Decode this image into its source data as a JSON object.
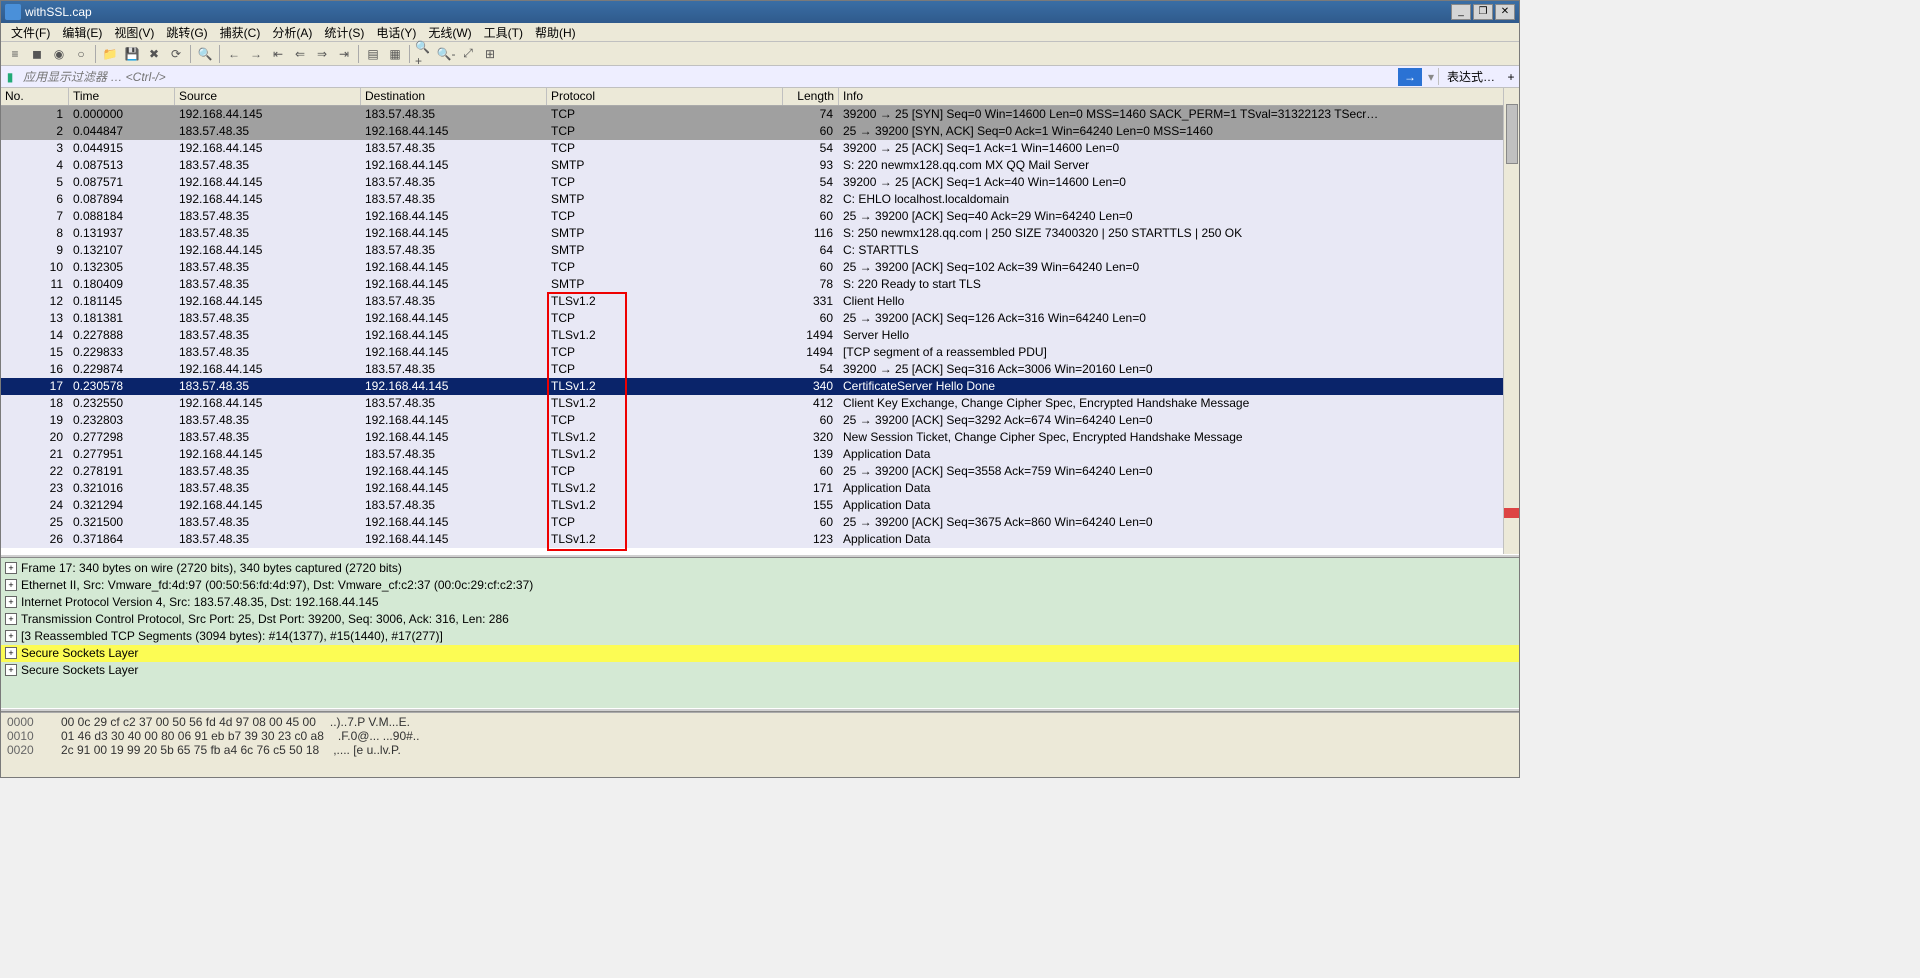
{
  "title": "withSSL.cap",
  "menu": [
    "文件(F)",
    "编辑(E)",
    "视图(V)",
    "跳转(G)",
    "捕获(C)",
    "分析(A)",
    "统计(S)",
    "电话(Y)",
    "无线(W)",
    "工具(T)",
    "帮助(H)"
  ],
  "filter_placeholder": "应用显示过滤器 … <Ctrl-/>",
  "expr_label": "表达式…",
  "columns": {
    "no": "No.",
    "time": "Time",
    "src": "Source",
    "dst": "Destination",
    "proto": "Protocol",
    "len": "Length",
    "info": "Info"
  },
  "packets": [
    {
      "no": 1,
      "time": "0.000000",
      "src": "192.168.44.145",
      "dst": "183.57.48.35",
      "proto": "TCP",
      "len": 74,
      "info": "39200 → 25 [SYN] Seq=0 Win=14600 Len=0 MSS=1460 SACK_PERM=1 TSval=31322123 TSecr…",
      "cls": "gray"
    },
    {
      "no": 2,
      "time": "0.044847",
      "src": "183.57.48.35",
      "dst": "192.168.44.145",
      "proto": "TCP",
      "len": 60,
      "info": "25 → 39200 [SYN, ACK] Seq=0 Ack=1 Win=64240 Len=0 MSS=1460",
      "cls": "gray"
    },
    {
      "no": 3,
      "time": "0.044915",
      "src": "192.168.44.145",
      "dst": "183.57.48.35",
      "proto": "TCP",
      "len": 54,
      "info": "39200 → 25 [ACK] Seq=1 Ack=1 Win=14600 Len=0",
      "cls": "lav"
    },
    {
      "no": 4,
      "time": "0.087513",
      "src": "183.57.48.35",
      "dst": "192.168.44.145",
      "proto": "SMTP",
      "len": 93,
      "info": "S: 220 newmx128.qq.com MX QQ Mail Server",
      "cls": "lav"
    },
    {
      "no": 5,
      "time": "0.087571",
      "src": "192.168.44.145",
      "dst": "183.57.48.35",
      "proto": "TCP",
      "len": 54,
      "info": "39200 → 25 [ACK] Seq=1 Ack=40 Win=14600 Len=0",
      "cls": "lav"
    },
    {
      "no": 6,
      "time": "0.087894",
      "src": "192.168.44.145",
      "dst": "183.57.48.35",
      "proto": "SMTP",
      "len": 82,
      "info": "C: EHLO localhost.localdomain",
      "cls": "lav"
    },
    {
      "no": 7,
      "time": "0.088184",
      "src": "183.57.48.35",
      "dst": "192.168.44.145",
      "proto": "TCP",
      "len": 60,
      "info": "25 → 39200 [ACK] Seq=40 Ack=29 Win=64240 Len=0",
      "cls": "lav"
    },
    {
      "no": 8,
      "time": "0.131937",
      "src": "183.57.48.35",
      "dst": "192.168.44.145",
      "proto": "SMTP",
      "len": 116,
      "info": "S: 250 newmx128.qq.com | 250 SIZE 73400320 | 250 STARTTLS | 250 OK",
      "cls": "lav"
    },
    {
      "no": 9,
      "time": "0.132107",
      "src": "192.168.44.145",
      "dst": "183.57.48.35",
      "proto": "SMTP",
      "len": 64,
      "info": "C: STARTTLS",
      "cls": "lav"
    },
    {
      "no": 10,
      "time": "0.132305",
      "src": "183.57.48.35",
      "dst": "192.168.44.145",
      "proto": "TCP",
      "len": 60,
      "info": "25 → 39200 [ACK] Seq=102 Ack=39 Win=64240 Len=0",
      "cls": "lav"
    },
    {
      "no": 11,
      "time": "0.180409",
      "src": "183.57.48.35",
      "dst": "192.168.44.145",
      "proto": "SMTP",
      "len": 78,
      "info": "S: 220 Ready to start TLS",
      "cls": "lav"
    },
    {
      "no": 12,
      "time": "0.181145",
      "src": "192.168.44.145",
      "dst": "183.57.48.35",
      "proto": "TLSv1.2",
      "len": 331,
      "info": "Client Hello",
      "cls": "lav"
    },
    {
      "no": 13,
      "time": "0.181381",
      "src": "183.57.48.35",
      "dst": "192.168.44.145",
      "proto": "TCP",
      "len": 60,
      "info": "25 → 39200 [ACK] Seq=126 Ack=316 Win=64240 Len=0",
      "cls": "lav"
    },
    {
      "no": 14,
      "time": "0.227888",
      "src": "183.57.48.35",
      "dst": "192.168.44.145",
      "proto": "TLSv1.2",
      "len": 1494,
      "info": "Server Hello",
      "cls": "lav"
    },
    {
      "no": 15,
      "time": "0.229833",
      "src": "183.57.48.35",
      "dst": "192.168.44.145",
      "proto": "TCP",
      "len": 1494,
      "info": "[TCP segment of a reassembled PDU]",
      "cls": "lav"
    },
    {
      "no": 16,
      "time": "0.229874",
      "src": "192.168.44.145",
      "dst": "183.57.48.35",
      "proto": "TCP",
      "len": 54,
      "info": "39200 → 25 [ACK] Seq=316 Ack=3006 Win=20160 Len=0",
      "cls": "lav"
    },
    {
      "no": 17,
      "time": "0.230578",
      "src": "183.57.48.35",
      "dst": "192.168.44.145",
      "proto": "TLSv1.2",
      "len": 340,
      "info": "CertificateServer Hello Done",
      "cls": "sel"
    },
    {
      "no": 18,
      "time": "0.232550",
      "src": "192.168.44.145",
      "dst": "183.57.48.35",
      "proto": "TLSv1.2",
      "len": 412,
      "info": "Client Key Exchange, Change Cipher Spec, Encrypted Handshake Message",
      "cls": "lav"
    },
    {
      "no": 19,
      "time": "0.232803",
      "src": "183.57.48.35",
      "dst": "192.168.44.145",
      "proto": "TCP",
      "len": 60,
      "info": "25 → 39200 [ACK] Seq=3292 Ack=674 Win=64240 Len=0",
      "cls": "lav"
    },
    {
      "no": 20,
      "time": "0.277298",
      "src": "183.57.48.35",
      "dst": "192.168.44.145",
      "proto": "TLSv1.2",
      "len": 320,
      "info": "New Session Ticket, Change Cipher Spec, Encrypted Handshake Message",
      "cls": "lav"
    },
    {
      "no": 21,
      "time": "0.277951",
      "src": "192.168.44.145",
      "dst": "183.57.48.35",
      "proto": "TLSv1.2",
      "len": 139,
      "info": "Application Data",
      "cls": "lav"
    },
    {
      "no": 22,
      "time": "0.278191",
      "src": "183.57.48.35",
      "dst": "192.168.44.145",
      "proto": "TCP",
      "len": 60,
      "info": "25 → 39200 [ACK] Seq=3558 Ack=759 Win=64240 Len=0",
      "cls": "lav"
    },
    {
      "no": 23,
      "time": "0.321016",
      "src": "183.57.48.35",
      "dst": "192.168.44.145",
      "proto": "TLSv1.2",
      "len": 171,
      "info": "Application Data",
      "cls": "lav"
    },
    {
      "no": 24,
      "time": "0.321294",
      "src": "192.168.44.145",
      "dst": "183.57.48.35",
      "proto": "TLSv1.2",
      "len": 155,
      "info": "Application Data",
      "cls": "lav"
    },
    {
      "no": 25,
      "time": "0.321500",
      "src": "183.57.48.35",
      "dst": "192.168.44.145",
      "proto": "TCP",
      "len": 60,
      "info": "25 → 39200 [ACK] Seq=3675 Ack=860 Win=64240 Len=0",
      "cls": "lav"
    },
    {
      "no": 26,
      "time": "0.371864",
      "src": "183.57.48.35",
      "dst": "192.168.44.145",
      "proto": "TLSv1.2",
      "len": 123,
      "info": "Application Data",
      "cls": "lav"
    }
  ],
  "details": [
    {
      "t": "Frame 17: 340 bytes on wire (2720 bits), 340 bytes captured (2720 bits)",
      "hl": false
    },
    {
      "t": "Ethernet II, Src: Vmware_fd:4d:97 (00:50:56:fd:4d:97), Dst: Vmware_cf:c2:37 (00:0c:29:cf:c2:37)",
      "hl": false
    },
    {
      "t": "Internet Protocol Version 4, Src: 183.57.48.35, Dst: 192.168.44.145",
      "hl": false
    },
    {
      "t": "Transmission Control Protocol, Src Port: 25, Dst Port: 39200, Seq: 3006, Ack: 316, Len: 286",
      "hl": false
    },
    {
      "t": "[3 Reassembled TCP Segments (3094 bytes): #14(1377), #15(1440), #17(277)]",
      "hl": false
    },
    {
      "t": "Secure Sockets Layer",
      "hl": true
    },
    {
      "t": "Secure Sockets Layer",
      "hl": false
    }
  ],
  "hex": [
    {
      "off": "0000",
      "b": "00 0c 29 cf c2 37 00 50  56 fd 4d 97 08 00 45 00",
      "a": "..)..7.P V.M...E."
    },
    {
      "off": "0010",
      "b": "01 46 d3 30 40 00 80 06  91 eb b7 39 30 23 c0 a8",
      "a": ".F.0@... ...90#.."
    },
    {
      "off": "0020",
      "b": "2c 91 00 19 99 20 5b 65  75 fb a4 6c 76 c5 50 18",
      "a": ",.... [e u..lv.P."
    }
  ],
  "toolbar_icons": [
    "list-icon",
    "square-icon",
    "circle-dot-icon",
    "circle-icon",
    "folder-icon",
    "save-icon",
    "close-icon",
    "reload-icon",
    "search-icon",
    "arrow-left-icon",
    "arrow-right-icon",
    "jump-back-icon",
    "jump-start-icon",
    "jump-end-icon",
    "jump-fwd-icon",
    "columns-icon",
    "rows-icon",
    "zoom-in-icon",
    "zoom-out-icon",
    "zoom-fit-icon",
    "resize-icon"
  ]
}
